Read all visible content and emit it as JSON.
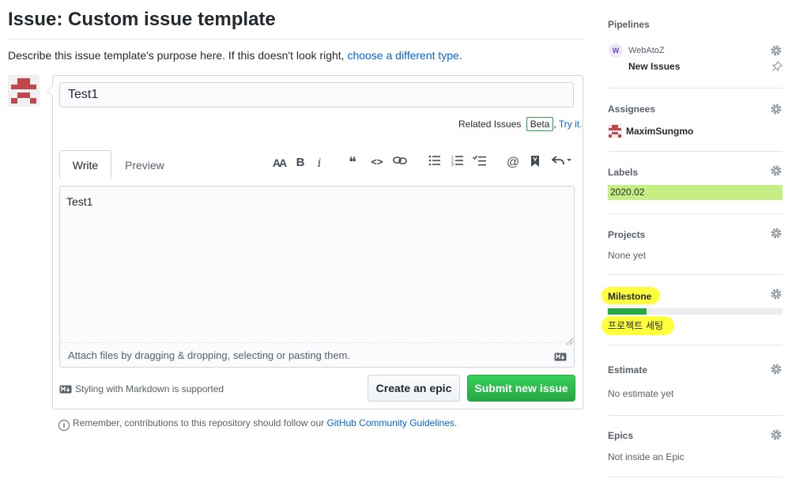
{
  "page": {
    "title": "Issue: Custom issue template",
    "description": "Describe this issue template's purpose here. If this doesn't look right, ",
    "description_link": "choose a different type",
    "description_end": "."
  },
  "form": {
    "title_value": "Test1",
    "related_label": "Related Issues",
    "beta_badge": "Beta",
    "related_sep": ",",
    "try_link": "Try it.",
    "tabs": {
      "write": "Write",
      "preview": "Preview"
    },
    "toolbar": {
      "header": "AA",
      "bold": "B",
      "italic": "i",
      "quote": "❝",
      "code": "<>",
      "link": "⊘",
      "bullet_list": "☰",
      "numbered_list": "☷",
      "task_list": "☑",
      "mention": "@",
      "reference": "🔖",
      "reply": "↶"
    },
    "body_value": "Test1",
    "attach_hint": "Attach files by dragging & dropping, selecting or pasting them.",
    "markdown_hint": "Styling with Markdown is supported",
    "create_epic_label": "Create an epic",
    "submit_label": "Submit new issue",
    "guidelines_text": "Remember, contributions to this repository should follow our ",
    "guidelines_link": "GitHub Community Guidelines",
    "guidelines_end": "."
  },
  "sidebar": {
    "pipelines": {
      "heading": "Pipelines",
      "avatar_letter": "W",
      "repo": "WebAtoZ",
      "pipeline": "New Issues"
    },
    "assignees": {
      "heading": "Assignees",
      "user": "MaximSungmo"
    },
    "labels": {
      "heading": "Labels",
      "label": "2020.02",
      "label_color": "#c5ef85"
    },
    "projects": {
      "heading": "Projects",
      "empty": "None yet"
    },
    "milestone": {
      "heading": "Milestone",
      "name": "프로젝트 세팅",
      "progress": 0.22,
      "highlight_color": "#ffff3b"
    },
    "estimate": {
      "heading": "Estimate",
      "empty": "No estimate yet"
    },
    "epics": {
      "heading": "Epics",
      "empty": "Not inside an Epic"
    }
  }
}
